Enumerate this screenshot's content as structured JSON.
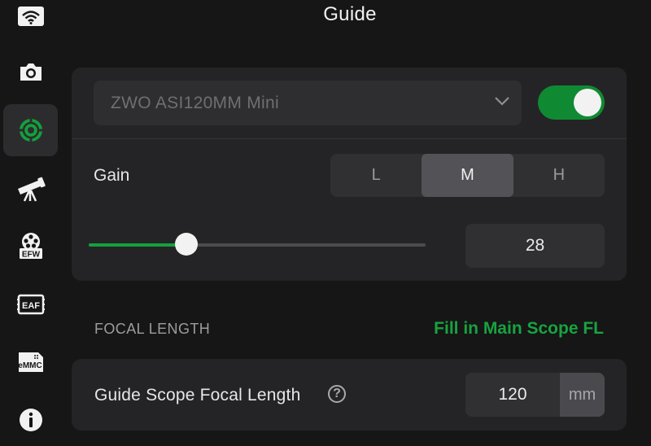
{
  "header": {
    "title": "Guide"
  },
  "sidebar": {
    "items": [
      {
        "icon": "wifi-icon",
        "active": false
      },
      {
        "icon": "camera-icon",
        "active": false
      },
      {
        "icon": "guide-target-icon",
        "active": true
      },
      {
        "icon": "telescope-icon",
        "active": false
      },
      {
        "icon": "efw-icon",
        "label": "EFW",
        "active": false
      },
      {
        "icon": "eaf-icon",
        "label": "EAF",
        "active": false
      },
      {
        "icon": "emmc-icon",
        "label": "eMMC",
        "active": false
      },
      {
        "icon": "info-icon",
        "active": false
      }
    ]
  },
  "camera": {
    "name": "ZWO ASI120MM Mini",
    "enabled": true
  },
  "gain": {
    "label": "Gain",
    "options": [
      "L",
      "M",
      "H"
    ],
    "selected": "M",
    "value": "28",
    "slider_fraction": 0.29
  },
  "focal_length": {
    "section_label": "FOCAL LENGTH",
    "fill_link": "Fill in Main Scope FL",
    "field_label": "Guide Scope Focal Length",
    "value": "120",
    "unit": "mm"
  },
  "colors": {
    "accent_green": "#14a03c",
    "toggle_on": "#0f8a33",
    "card_bg": "#242426",
    "page_bg": "#161616"
  }
}
